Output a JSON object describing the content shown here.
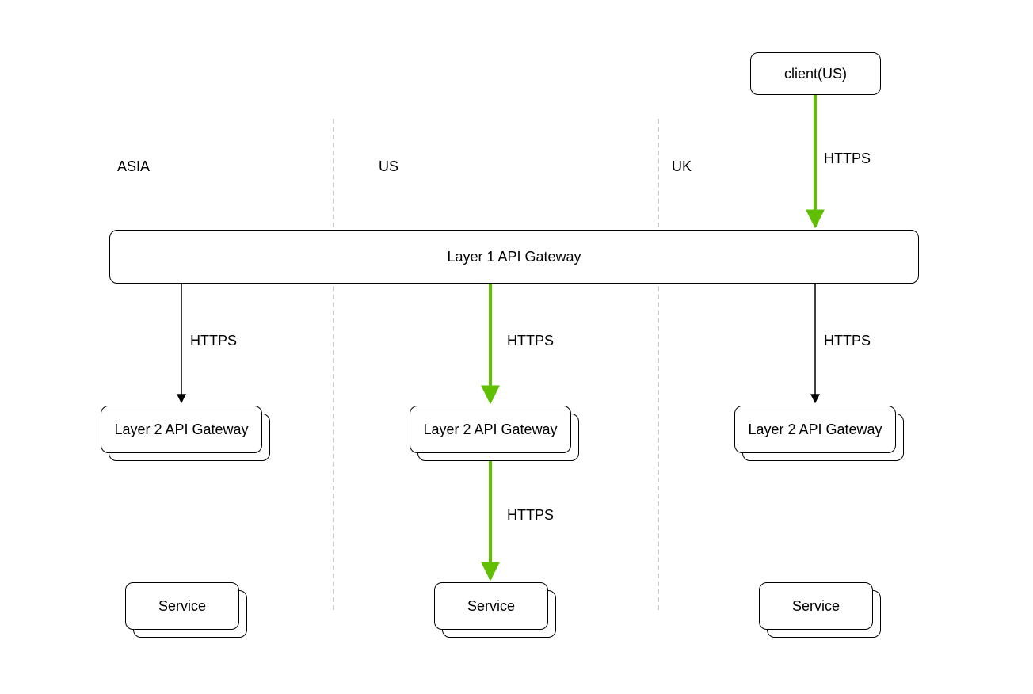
{
  "regions": {
    "asia": "ASIA",
    "us": "US",
    "uk": "UK"
  },
  "nodes": {
    "client": "client(US)",
    "layer1": "Layer 1 API Gateway",
    "layer2_asia": "Layer 2 API Gateway",
    "layer2_us": "Layer 2 API Gateway",
    "layer2_uk": "Layer 2 API Gateway",
    "service_asia": "Service",
    "service_us": "Service",
    "service_uk": "Service"
  },
  "edges": {
    "client_to_l1": "HTTPS",
    "l1_to_l2_asia": "HTTPS",
    "l1_to_l2_us": "HTTPS",
    "l1_to_l2_uk": "HTTPS",
    "l2_to_svc_us": "HTTPS"
  },
  "colors": {
    "highlight": "#5fbf00",
    "normal": "#000000",
    "divider": "#cccccc"
  }
}
